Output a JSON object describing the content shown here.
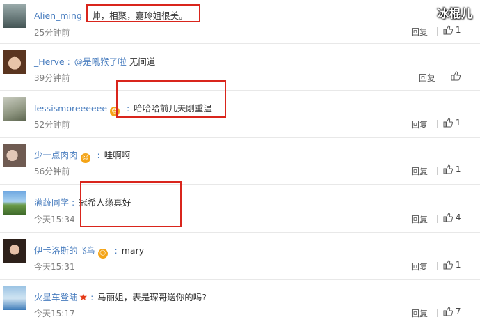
{
  "watermark": "冰棍儿",
  "comments": [
    {
      "user": "Alien_ming",
      "mention": "",
      "text": "帅，相聚，嘉玲姐很美。",
      "time": "25分钟前",
      "reply": "回复",
      "likes": "1"
    },
    {
      "user": "_Herve",
      "mention": "@是吼猴了啦",
      "text": "无间道",
      "time": "39分钟前",
      "reply": "回复",
      "likes": ""
    },
    {
      "user": "lessismoreeeeee",
      "mention": "",
      "text": "哈哈哈前几天刚重温",
      "time": "52分钟前",
      "reply": "回复",
      "likes": "1"
    },
    {
      "user": "少一点肉肉",
      "mention": "",
      "text": "哇啊啊",
      "time": "56分钟前",
      "reply": "回复",
      "likes": "1"
    },
    {
      "user": "满蔬同学",
      "mention": "",
      "text": "冠希人缘真好",
      "time": "今天15:34",
      "reply": "回复",
      "likes": "4"
    },
    {
      "user": "伊卡洛斯的飞鸟",
      "mention": "",
      "text": "mary",
      "time": "今天15:31",
      "reply": "回复",
      "likes": "1"
    },
    {
      "user": "火星车登陆",
      "mention": "",
      "text": "马丽姐，表是琛哥送你的吗?",
      "time": "今天15:17",
      "reply": "回复",
      "likes": "7"
    }
  ]
}
